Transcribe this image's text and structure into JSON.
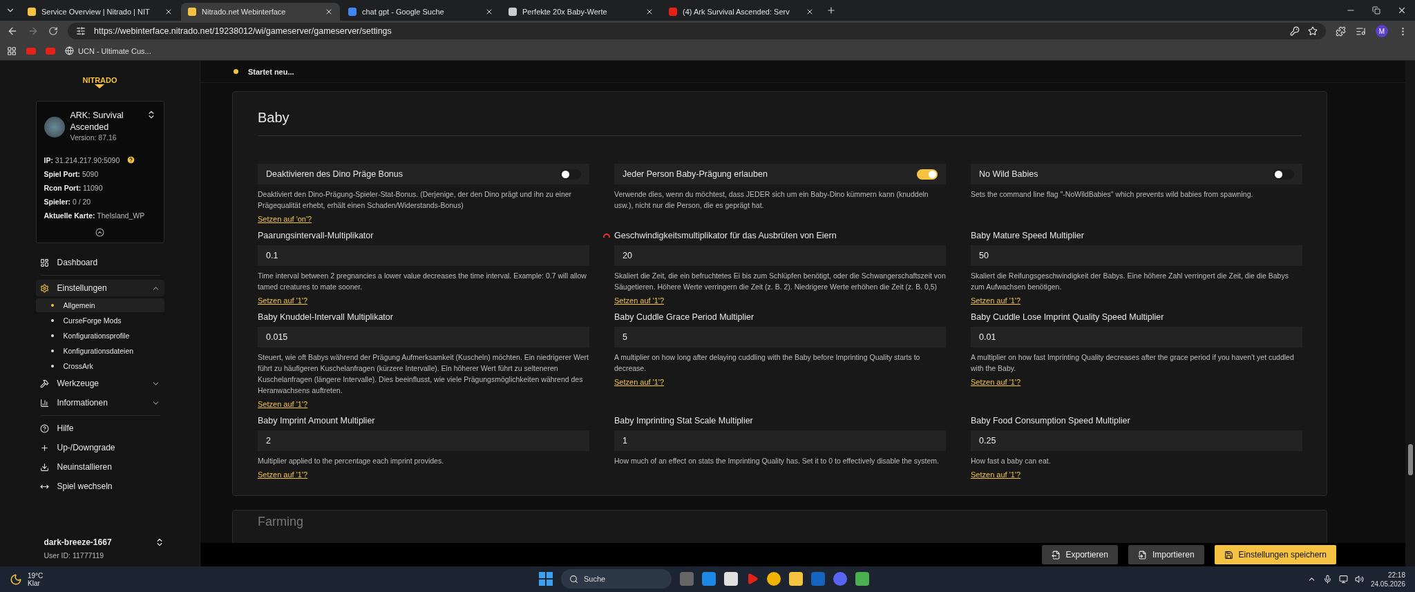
{
  "browser": {
    "tabs": [
      {
        "title": "Service Overview | Nitrado | NIT",
        "selected": false
      },
      {
        "title": "Nitrado.net Webinterface",
        "selected": true
      },
      {
        "title": "chat gpt - Google Suche",
        "selected": false
      },
      {
        "title": "Perfekte 20x Baby-Werte",
        "selected": false
      },
      {
        "title": "(4) Ark Survival Ascended: Serv",
        "selected": false
      }
    ],
    "url": "https://webinterface.nitrado.net/19238012/wi/gameserver/gameserver/settings",
    "bookmarks": [
      {
        "label": "UCN - Ultimate Cus..."
      }
    ],
    "profile": "M"
  },
  "sidebar": {
    "logo": "NITRADO",
    "server": {
      "name": "ARK: Survival Ascended",
      "version": "Version: 87.16",
      "info": [
        {
          "label": "IP:",
          "value": "31.214.217.90:5090",
          "help": true
        },
        {
          "label": "Spiel Port:",
          "value": "5090",
          "help": false
        },
        {
          "label": "Rcon Port:",
          "value": "11090",
          "help": false
        },
        {
          "label": "Spieler:",
          "value": "0 / 20",
          "help": false
        },
        {
          "label": "Aktuelle Karte:",
          "value": "TheIsland_WP",
          "help": false
        }
      ]
    },
    "nav": [
      {
        "label": "Dashboard",
        "selected": false
      },
      {
        "label": "Einstellungen",
        "selected": true,
        "expanded": true,
        "children": [
          {
            "label": "Allgemein",
            "selected": true
          },
          {
            "label": "CurseForge Mods",
            "selected": false
          },
          {
            "label": "Konfigurationsprofile",
            "selected": false
          },
          {
            "label": "Konfigurationsdateien",
            "selected": false
          },
          {
            "label": "CrossArk",
            "selected": false
          }
        ]
      },
      {
        "label": "Werkzeuge",
        "selected": false,
        "expanded": false
      },
      {
        "label": "Informationen",
        "selected": false,
        "expanded": false
      },
      {
        "label": "Hilfe",
        "selected": false
      },
      {
        "label": "Up-/Downgrade",
        "selected": false
      },
      {
        "label": "Neuinstallieren",
        "selected": false
      },
      {
        "label": "Spiel wechseln",
        "selected": false
      }
    ],
    "user": {
      "name": "dark-breeze-1667",
      "id": "User ID: 11777119"
    }
  },
  "status": {
    "text": "Startet neu...",
    "color": "#f5c242"
  },
  "section": {
    "title": "Baby",
    "settings": [
      {
        "kind": "toggle",
        "label": "Deaktivieren des Dino Präge Bonus",
        "on": false,
        "description": "Deaktiviert den Dino-Prägung-Spieler-Stat-Bonus. (Derjenige, der den Dino prägt und ihn zu einer Prägequalität erhebt, erhält einen Schaden/Widerstands-Bonus)",
        "reset": "Setzen auf 'on'?"
      },
      {
        "kind": "toggle",
        "label": "Jeder Person Baby-Prägung erlauben",
        "on": true,
        "description": "Verwende dies, wenn du möchtest, dass JEDER sich um ein Baby-Dino kümmern kann (knuddeln usw.), nicht nur die Person, die es geprägt hat."
      },
      {
        "kind": "toggle",
        "label": "No Wild Babies",
        "on": false,
        "description": "Sets the command line flag \"-NoWildBabies\" which prevents wild babies from spawning."
      },
      {
        "kind": "number",
        "label": "Paarungsintervall-Multiplikator",
        "modified": false,
        "value": "0.1",
        "description": "Time interval between 2 pregnancies a lower value decreases the time interval. Example: 0.7 will allow tamed creatures to mate sooner.",
        "reset": "Setzen auf '1'?"
      },
      {
        "kind": "number",
        "label": "Geschwindigkeitsmultiplikator für das Ausbrüten von Eiern",
        "modified": true,
        "value": "20",
        "description": "Skaliert die Zeit, die ein befruchtetes Ei bis zum Schlüpfen benötigt, oder die Schwangerschaftszeit von Säugetieren. Höhere Werte verringern die Zeit (z. B. 2). Niedrigere Werte erhöhen die Zeit (z. B. 0,5)",
        "reset": "Setzen auf '1'?"
      },
      {
        "kind": "number",
        "label": "Baby Mature Speed Multiplier",
        "modified": false,
        "value": "50",
        "description": "Skaliert die Reifungsgeschwindigkeit der Babys. Eine höhere Zahl verringert die Zeit, die die Babys zum Aufwachsen benötigen.",
        "reset": "Setzen auf '1'?"
      },
      {
        "kind": "number",
        "label": "Baby Knuddel-Intervall Multiplikator",
        "modified": false,
        "value": "0.015",
        "description": "Steuert, wie oft Babys während der Prägung Aufmerksamkeit (Kuscheln) möchten. Ein niedrigerer Wert führt zu häufigeren Kuschelanfragen (kürzere Intervalle). Ein höherer Wert führt zu selteneren Kuschelanfragen (längere Intervalle). Dies beeinflusst, wie viele Prägungsmöglichkeiten während des Heranwachsens auftreten.",
        "reset": "Setzen auf '1'?"
      },
      {
        "kind": "number",
        "label": "Baby Cuddle Grace Period Multiplier",
        "modified": false,
        "value": "5",
        "description": "A multiplier on how long after delaying cuddling with the Baby before Imprinting Quality starts to decrease.",
        "reset": "Setzen auf '1'?"
      },
      {
        "kind": "number",
        "label": "Baby Cuddle Lose Imprint Quality Speed Multiplier",
        "modified": false,
        "value": "0.01",
        "description": "A multiplier on how fast Imprinting Quality decreases after the grace period if you haven't yet cuddled with the Baby.",
        "reset": "Setzen auf '1'?"
      },
      {
        "kind": "number",
        "label": "Baby Imprint Amount Multiplier",
        "modified": false,
        "value": "2",
        "description": "Multiplier applied to the percentage each imprint provides.",
        "reset": "Setzen auf '1'?"
      },
      {
        "kind": "number",
        "label": "Baby Imprinting Stat Scale Multiplier",
        "modified": false,
        "value": "1",
        "description": "How much of an effect on stats the Imprinting Quality has. Set it to 0 to effectively disable the system."
      },
      {
        "kind": "number",
        "label": "Baby Food Consumption Speed Multiplier",
        "modified": false,
        "value": "0.25",
        "description": "How fast a baby can eat.",
        "reset": "Setzen auf '1'?"
      }
    ]
  },
  "next_section": {
    "title": "Farming"
  },
  "actions": [
    {
      "kind": "secondary",
      "label": "Exportieren"
    },
    {
      "kind": "secondary",
      "label": "Importieren"
    },
    {
      "kind": "primary",
      "label": "Einstellungen speichern"
    }
  ],
  "taskbar": {
    "weather": {
      "temp": "19°C",
      "condition": "Klar"
    },
    "search": {
      "placeholder": "Suche"
    },
    "time": "22:18",
    "date": "24.05.2026"
  }
}
